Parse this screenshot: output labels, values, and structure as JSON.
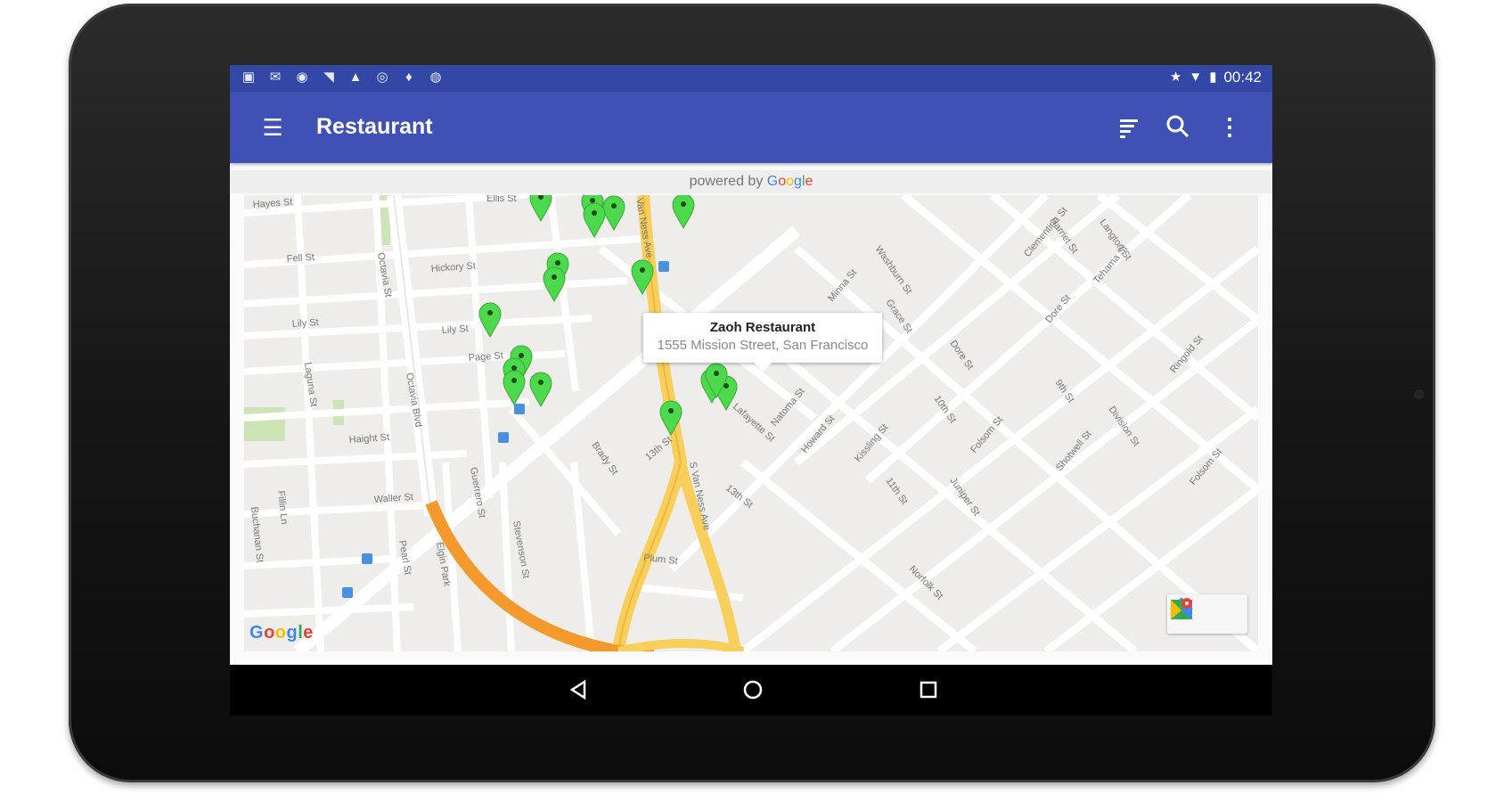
{
  "status_bar": {
    "left_icons": [
      "image-icon",
      "mail-icon",
      "location-icon",
      "signal-icon",
      "alert-icon",
      "location-icon",
      "pin-icon",
      "chat-icon"
    ],
    "right_icons": [
      "star-icon",
      "wifi-icon",
      "battery-icon"
    ],
    "time": "00:42"
  },
  "app_bar": {
    "title": "Restaurant",
    "actions": [
      "filter-icon",
      "search-icon",
      "more-icon"
    ],
    "color": "#3f51b5"
  },
  "attribution": {
    "powered_by": "powered by",
    "google": "Google"
  },
  "map": {
    "street_labels": [
      "Hayes St",
      "Ellis St",
      "Fell St",
      "Hickory St",
      "Lily St",
      "Page St",
      "Haight St",
      "Waller St",
      "Octavia Blvd",
      "Gough St",
      "Laguna St",
      "Buchanan St",
      "Pearl St",
      "Elgin Park",
      "Guerrero St",
      "Stevenson St",
      "Brady St",
      "Plum St",
      "13th St",
      "12th St",
      "Mission St",
      "Van Ness Ave",
      "Lafayette St",
      "Howard St",
      "Folsom St",
      "Harrison St",
      "Bryant St",
      "Division St",
      "Shotwell St",
      "Juniper St",
      "Kissling St",
      "11th St",
      "10th St",
      "Natoma St",
      "Minna St",
      "Dore St"
    ],
    "info_window": {
      "title": "Zaoh Restaurant",
      "address": "1555 Mission Street, San Francisco"
    },
    "marker_color": "#4cd94c",
    "google_logo": "Google",
    "toolbar": [
      "directions-icon",
      "google-maps-icon"
    ]
  },
  "nav_bar": [
    "back-icon",
    "home-icon",
    "recents-icon"
  ]
}
